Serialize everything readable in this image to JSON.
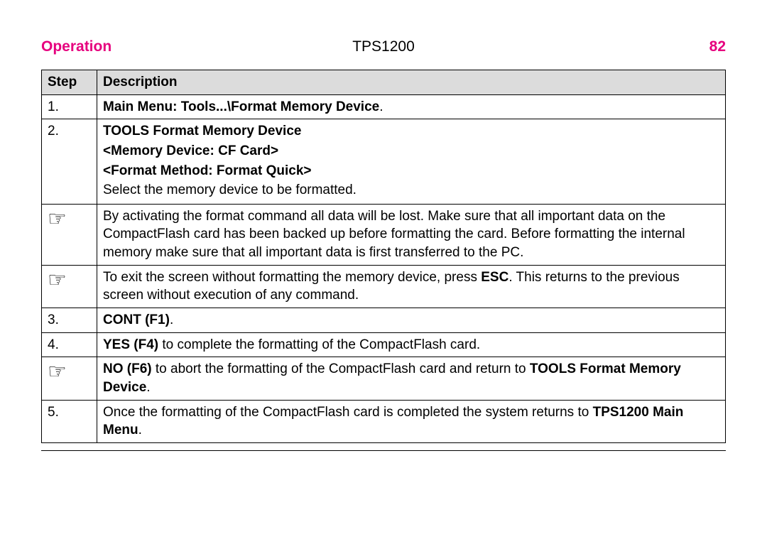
{
  "header": {
    "left": "Operation",
    "center": "TPS1200",
    "right": "82"
  },
  "table": {
    "col_step": "Step",
    "col_desc": "Description"
  },
  "rows": {
    "r1": {
      "step": "1.",
      "desc_bold": "Main Menu: Tools...\\Format Memory Device"
    },
    "r2": {
      "step": "2.",
      "l1": "TOOLS Format Memory Device",
      "l2": "<Memory Device: CF Card>",
      "l3": "<Format Method: Format Quick>",
      "l4": "Select the memory device to be formatted."
    },
    "r3": {
      "icon": "☞",
      "text": "By activating the format command all data will be lost. Make sure that all important data on the CompactFlash card has been backed up before formatting the card. Before formatting the internal memory make sure that all important data is first transferred to the PC."
    },
    "r4": {
      "icon": "☞",
      "pre": "To exit the screen without formatting the memory device, press ",
      "key": "ESC",
      "post": ". This returns to the previous screen without execution of any command."
    },
    "r5": {
      "step": "3.",
      "label": "CONT (F1)"
    },
    "r6": {
      "step": "4.",
      "key": "YES (F4)",
      "post": " to complete the formatting of the CompactFlash card."
    },
    "r7": {
      "icon": "☞",
      "key": "NO (F6)",
      "mid": " to abort the formatting of the CompactFlash card and return to ",
      "tail": "TOOLS Format Memory Device"
    },
    "r8": {
      "step": "5.",
      "pre": "Once the formatting of the CompactFlash card is completed the system returns to ",
      "tail": "TPS1200 Main Menu"
    }
  }
}
